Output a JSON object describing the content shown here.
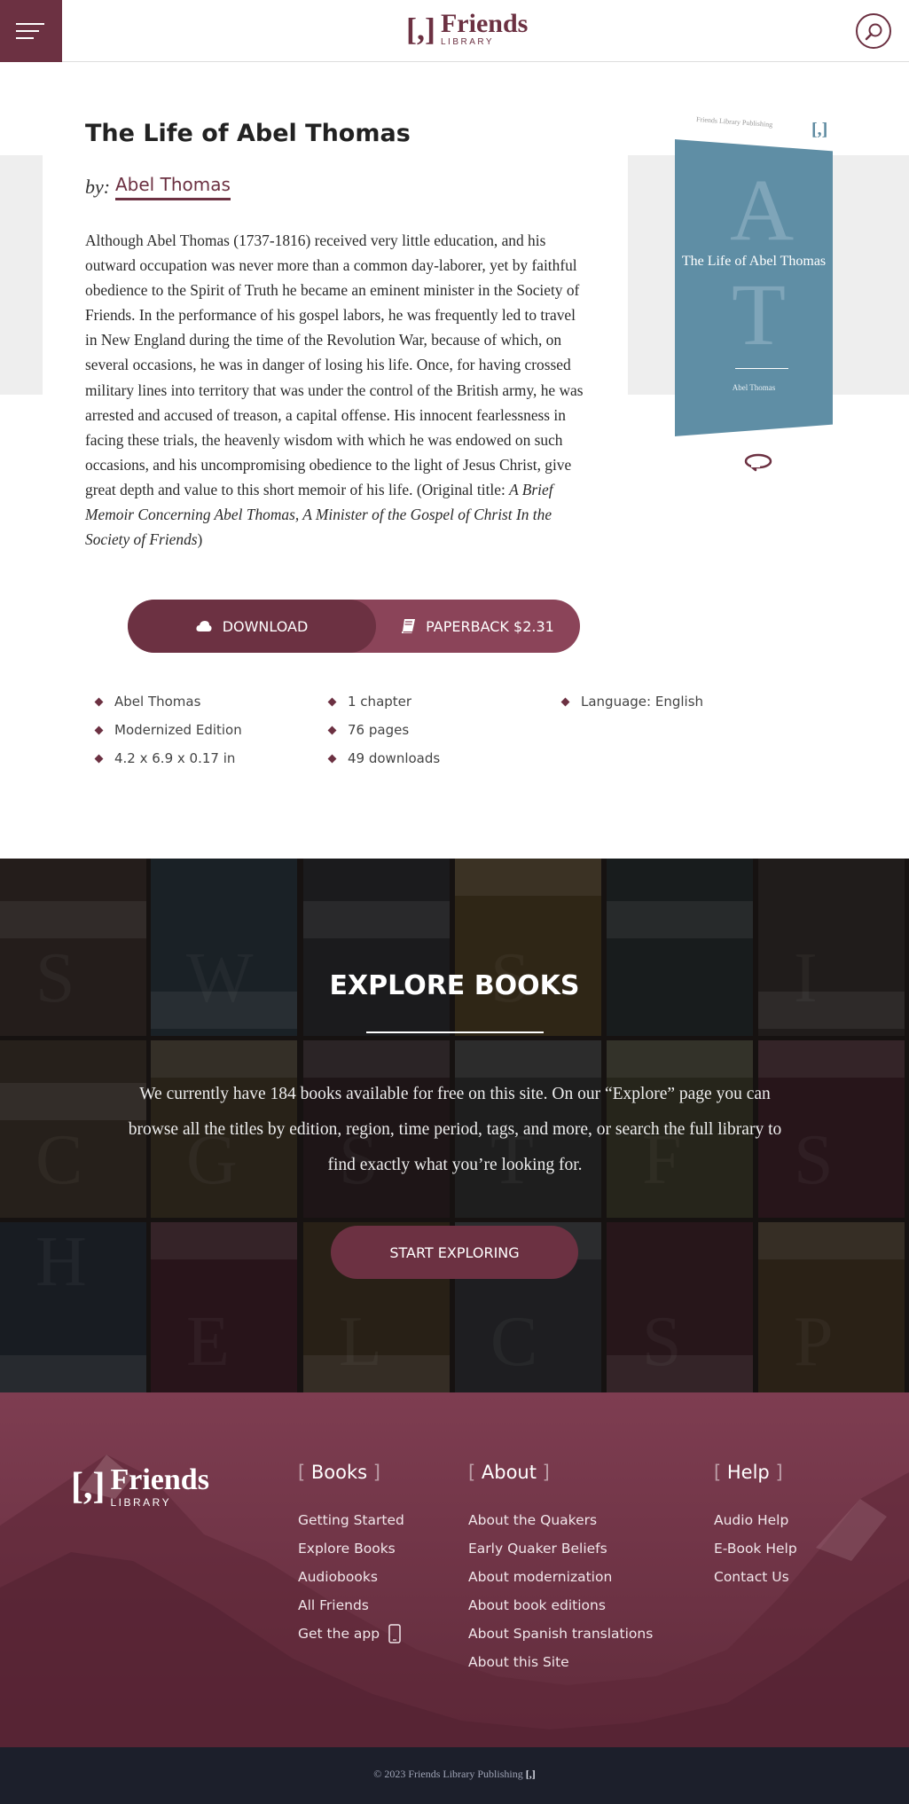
{
  "header": {
    "logo_bracket": "[,]",
    "logo_word": "Friends",
    "logo_sub": "LIBRARY"
  },
  "book": {
    "title": "The Life of Abel Thomas",
    "by_label": "by:",
    "author": "Abel Thomas",
    "description_main": "Although Abel Thomas (1737-1816) received very little education, and his outward occupation was never more than a common day-laborer, yet by faithful obedience to the Spirit of Truth he became an eminent minister in the Society of Friends. In the performance of his gospel labors, he was frequently led to travel in New England during the time of the Revolution War, because of which, on several occasions, he was in danger of losing his life. Once, for having crossed military lines into territory that was under the control of the British army, he was arrested and accused of treason, a capital offense. His innocent fearlessness in facing these trials, the heavenly wisdom with which he was endowed on such occasions, and his uncompromising obedience to the light of Jesus Christ, give great depth and value to this short memoir of his life. (Original title: ",
    "description_original_title": "A Brief Memoir Concerning Abel Thomas, A Minister of the Gospel of Christ In the Society of Friends",
    "description_close": ")",
    "cover": {
      "publisher": "Friends Library Publishing",
      "mark": "[,]",
      "letter_top": "A",
      "letter_bottom": "T",
      "title": "The Life of Abel Thomas",
      "author": "Abel Thomas",
      "color": "#5f8ea5"
    },
    "download_label": "DOWNLOAD",
    "paperback_label": "PAPERBACK $2.31",
    "meta_col1": [
      "Abel Thomas",
      "Modernized Edition",
      "4.2 x 6.9 x 0.17 in"
    ],
    "meta_col2": [
      "1 chapter",
      "76 pages",
      "49 downloads"
    ],
    "meta_col3": [
      "Language: English"
    ]
  },
  "explore": {
    "title": "EXPLORE BOOKS",
    "text": "We currently have 184 books available for free on this site. On our “Explore” page you can browse all the titles by edition, region, time period, tags, and more, or search the full library to find exactly what you’re looking for.",
    "button": "START EXPLORING"
  },
  "footer": {
    "logo_bracket": "[,]",
    "logo_word": "Friends",
    "logo_sub": "LIBRARY",
    "columns": [
      {
        "heading": "Books",
        "links": [
          "Getting Started",
          "Explore Books",
          "Audiobooks",
          "All Friends",
          "Get the app"
        ]
      },
      {
        "heading": "About",
        "links": [
          "About the Quakers",
          "Early Quaker Beliefs",
          "About modernization",
          "About book editions",
          "About Spanish translations",
          "About this Site"
        ]
      },
      {
        "heading": "Help",
        "links": [
          "Audio Help",
          "E-Book Help",
          "Contact Us"
        ]
      }
    ],
    "copyright": "© 2023 Friends Library Publishing"
  },
  "colors": {
    "brand": "#6c3142",
    "brand_light": "#8b4459",
    "footer_bottom": "#1c1f2b"
  },
  "icons": [
    "menu-icon",
    "search-icon",
    "cloud-icon",
    "book-icon",
    "rotate-icon",
    "phone-icon"
  ]
}
